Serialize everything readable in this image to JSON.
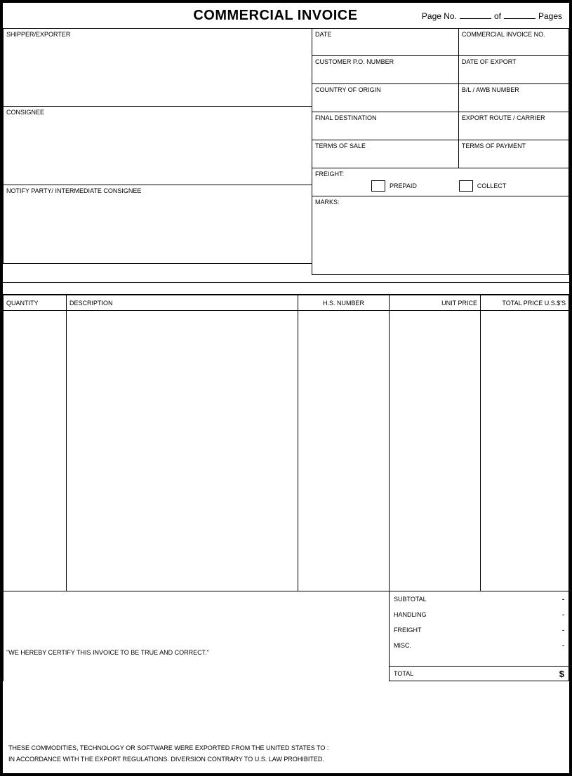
{
  "header": {
    "title": "COMMERCIAL INVOICE",
    "page_label": "Page No.",
    "of_label": "of",
    "pages_label": "Pages"
  },
  "fields": {
    "shipper": "SHIPPER/EXPORTER",
    "consignee": "CONSIGNEE",
    "notify": "NOTIFY PARTY/ INTERMEDIATE CONSIGNEE",
    "date": "DATE",
    "invoice_no": "COMMERCIAL INVOICE NO.",
    "customer_po": "CUSTOMER P.O. NUMBER",
    "date_export": "DATE OF EXPORT",
    "country_origin": "COUNTRY OF ORIGIN",
    "bl_awb": "B/L / AWB NUMBER",
    "final_dest": "FINAL DESTINATION",
    "export_route": "EXPORT ROUTE / CARRIER",
    "terms_sale": "TERMS OF SALE",
    "terms_payment": "TERMS OF PAYMENT",
    "freight": "FREIGHT:",
    "prepaid": "PREPAID",
    "collect": "COLLECT",
    "marks": "MARKS:"
  },
  "columns": {
    "quantity": "QUANTITY",
    "description": "DESCRIPTION",
    "hs_number": "H.S. NUMBER",
    "unit_price": "UNIT PRICE",
    "total_price": "TOTAL PRICE U.S.$'S"
  },
  "totals": {
    "subtotal": {
      "label": "SUBTOTAL",
      "value": "-"
    },
    "handling": {
      "label": "HANDLING",
      "value": "-"
    },
    "freight": {
      "label": "FREIGHT",
      "value": "-"
    },
    "misc": {
      "label": "MISC.",
      "value": "-"
    },
    "total": {
      "label": "TOTAL",
      "value": "$"
    }
  },
  "certification": "\"WE HEREBY CERTIFY THIS INVOICE TO BE TRUE AND CORRECT.\"",
  "footer": {
    "line1": "THESE COMMODITIES, TECHNOLOGY OR SOFTWARE WERE EXPORTED FROM THE UNITED STATES TO :",
    "line2": "IN ACCORDANCE WITH THE EXPORT REGULATIONS.  DIVERSION CONTRARY TO U.S. LAW PROHIBITED."
  }
}
